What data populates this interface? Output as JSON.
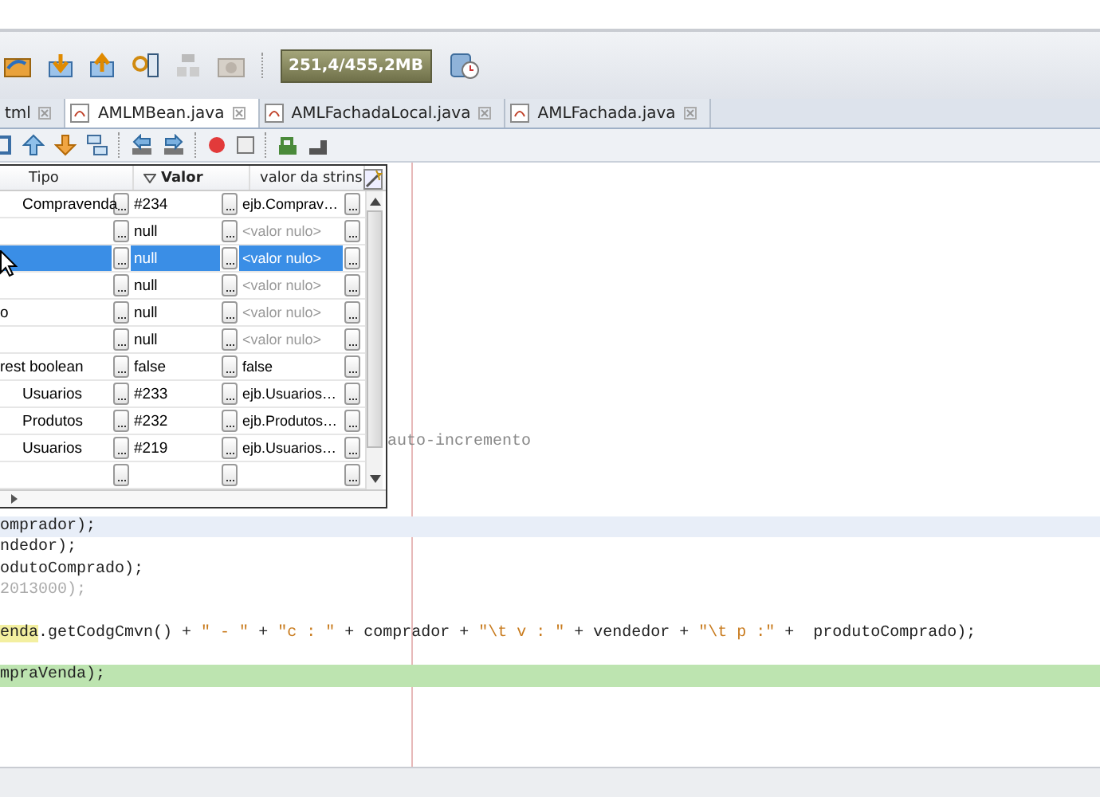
{
  "toolbar": {
    "memory": "251,4/455,2MB"
  },
  "tabs": [
    {
      "label": "tml",
      "selected": false
    },
    {
      "label": "AMLMBean.java",
      "selected": true
    },
    {
      "label": "AMLFachadaLocal.java",
      "selected": false
    },
    {
      "label": "AMLFachada.java",
      "selected": false
    }
  ],
  "variables_table": {
    "columns": [
      {
        "label": "Tipo",
        "sorted": false
      },
      {
        "label": "Valor",
        "sorted": true
      },
      {
        "label": "valor da strins",
        "sorted": false
      }
    ],
    "rows": [
      {
        "tipo": "Compravenda",
        "valor": "#234",
        "string_value": "ejb.Comprav…",
        "null_string": false,
        "selected": false
      },
      {
        "valor": "null",
        "string_value": "<valor nulo>",
        "null_string": true,
        "selected": false
      },
      {
        "valor": "null",
        "string_value": "<valor nulo>",
        "null_string": true,
        "selected": true
      },
      {
        "valor": "null",
        "string_value": "<valor nulo>",
        "null_string": true,
        "selected": false
      },
      {
        "column_1": "o",
        "valor": "null",
        "string_value": "<valor nulo>",
        "null_string": true,
        "selected": false
      },
      {
        "valor": "null",
        "string_value": "<valor nulo>",
        "null_string": true,
        "selected": false
      },
      {
        "column_1": "rest boolean",
        "valor": "false",
        "string_value": "false",
        "null_string": false,
        "selected": false
      },
      {
        "tipo": "Usuarios",
        "valor": "#233",
        "string_value": "ejb.Usuarios…",
        "null_string": false,
        "selected": false
      },
      {
        "tipo": "Produtos",
        "valor": "#232",
        "string_value": "ejb.Produtos…",
        "null_string": false,
        "selected": false
      },
      {
        "tipo": "Usuarios",
        "valor": "#219",
        "string_value": "ejb.Usuarios…",
        "null_string": false,
        "selected": false
      },
      {
        "selected": false
      }
    ]
  },
  "code_lines": [
    {
      "kind": "comment",
      "text": "auto-incremento"
    },
    {
      "kind": "blank"
    },
    {
      "kind": "blank"
    },
    {
      "kind": "blank"
    },
    {
      "kind": "caret",
      "tokens": [
        {
          "kind": "plain",
          "text": "omprador);"
        }
      ]
    },
    {
      "kind": "code",
      "tokens": [
        {
          "kind": "plain",
          "text": "ndedor);"
        }
      ]
    },
    {
      "kind": "code",
      "tokens": [
        {
          "kind": "plain",
          "text": "odutoComprado);"
        }
      ]
    },
    {
      "kind": "code",
      "tokens": [
        {
          "kind": "dim",
          "text": "2013000);"
        }
      ]
    },
    {
      "kind": "blank"
    },
    {
      "kind": "code",
      "tokens": [
        {
          "kind": "marked",
          "text": "enda"
        },
        {
          "kind": "plain",
          "text": ".getCodgCmvn() + "
        },
        {
          "kind": "string",
          "text": "\" - \""
        },
        {
          "kind": "plain",
          "text": " + "
        },
        {
          "kind": "string",
          "text": "\"c : \""
        },
        {
          "kind": "plain",
          "text": " + comprador + "
        },
        {
          "kind": "string",
          "text": "\"\\t v : \""
        },
        {
          "kind": "plain",
          "text": " + vendedor + "
        },
        {
          "kind": "string",
          "text": "\"\\t p :\""
        },
        {
          "kind": "plain",
          "text": " +  produtoComprado);"
        }
      ]
    },
    {
      "kind": "blank"
    },
    {
      "kind": "current",
      "tokens": [
        {
          "kind": "plain",
          "text": "mpraVenda);"
        }
      ]
    }
  ]
}
